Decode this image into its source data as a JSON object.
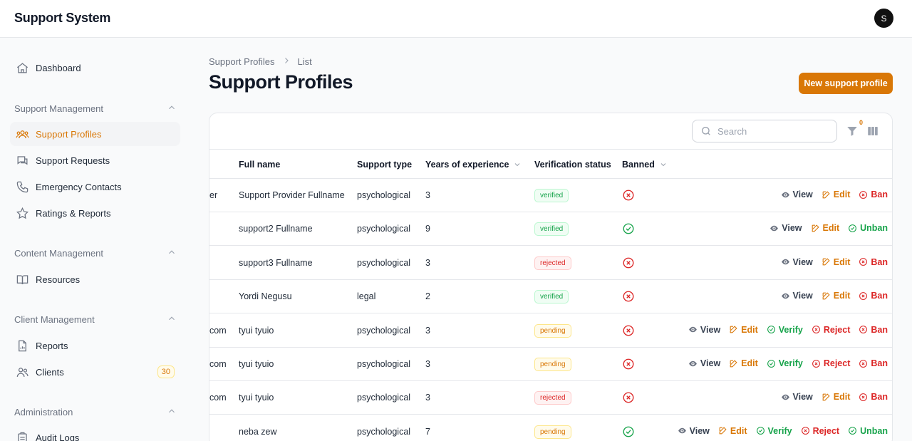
{
  "app": {
    "title": "Support System",
    "avatar_initial": "S"
  },
  "sidebar": {
    "dashboard": "Dashboard",
    "groups": [
      {
        "label": "Support Management",
        "items": [
          "Support Profiles",
          "Support Requests",
          "Emergency Contacts",
          "Ratings & Reports"
        ]
      },
      {
        "label": "Content Management",
        "items": [
          "Resources"
        ]
      },
      {
        "label": "Client Management",
        "items": [
          "Reports",
          "Clients"
        ],
        "clients_badge": "30"
      },
      {
        "label": "Administration",
        "items": [
          "Audit Logs"
        ]
      }
    ]
  },
  "breadcrumb": {
    "parent": "Support Profiles",
    "current": "List"
  },
  "page": {
    "title": "Support Profiles",
    "new_button": "New support profile"
  },
  "toolbar": {
    "search_placeholder": "Search",
    "filter_count": "0"
  },
  "table": {
    "columns": [
      "Full name",
      "Support type",
      "Years of experience",
      "Verification status",
      "Banned"
    ],
    "rows": [
      {
        "email_tail": "er",
        "name": "Support Provider Fullname",
        "type": "psychological",
        "years": "3",
        "status": "verified",
        "banned": true
      },
      {
        "email_tail": "",
        "name": "support2 Fullname",
        "type": "psychological",
        "years": "9",
        "status": "verified",
        "banned": false
      },
      {
        "email_tail": "",
        "name": "support3 Fullname",
        "type": "psychological",
        "years": "3",
        "status": "rejected",
        "banned": true
      },
      {
        "email_tail": "",
        "name": "Yordi Negusu",
        "type": "legal",
        "years": "2",
        "status": "verified",
        "banned": true
      },
      {
        "email_tail": "com",
        "name": "tyui tyuio",
        "type": "psychological",
        "years": "3",
        "status": "pending",
        "banned": true
      },
      {
        "email_tail": "com",
        "name": "tyui tyuio",
        "type": "psychological",
        "years": "3",
        "status": "pending",
        "banned": true
      },
      {
        "email_tail": "com",
        "name": "tyui tyuio",
        "type": "psychological",
        "years": "3",
        "status": "rejected",
        "banned": true
      },
      {
        "email_tail": "",
        "name": "neba zew",
        "type": "psychological",
        "years": "7",
        "status": "pending",
        "banned": false
      }
    ]
  },
  "actions": {
    "view": "View",
    "edit": "Edit",
    "ban": "Ban",
    "unban": "Unban",
    "verify": "Verify",
    "reject": "Reject"
  },
  "colors": {
    "accent": "#d97706",
    "success": "#16a34a",
    "danger": "#dc2626"
  }
}
